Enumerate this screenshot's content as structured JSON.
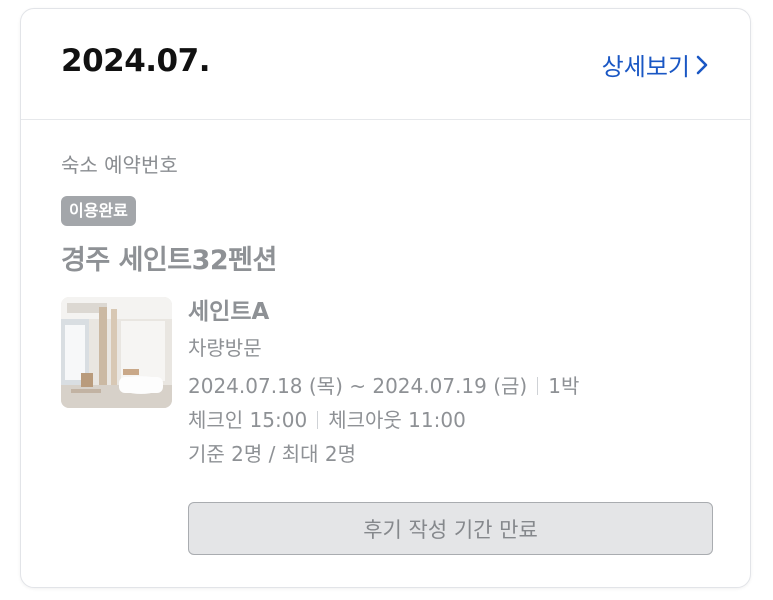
{
  "header": {
    "order_date": "2024.07.",
    "detail_link_label": "상세보기",
    "accent_color": "#1a57c4"
  },
  "reservation": {
    "label": "숙소 예약번호",
    "status_badge": "이용완료",
    "property_name": "경주 세인트32펜션"
  },
  "room": {
    "name": "세인트A",
    "visit_type": "차량방문",
    "dates": "2024.07.18 (목) ~ 2024.07.19 (금)",
    "nights": "1박",
    "check_in": "체크인 15:00",
    "check_out": "체크아웃 11:00",
    "capacity": "기준 2명 / 최대 2명",
    "thumbnail_icon": "room-photo"
  },
  "actions": {
    "review_button_label": "후기 작성 기간 만료"
  }
}
